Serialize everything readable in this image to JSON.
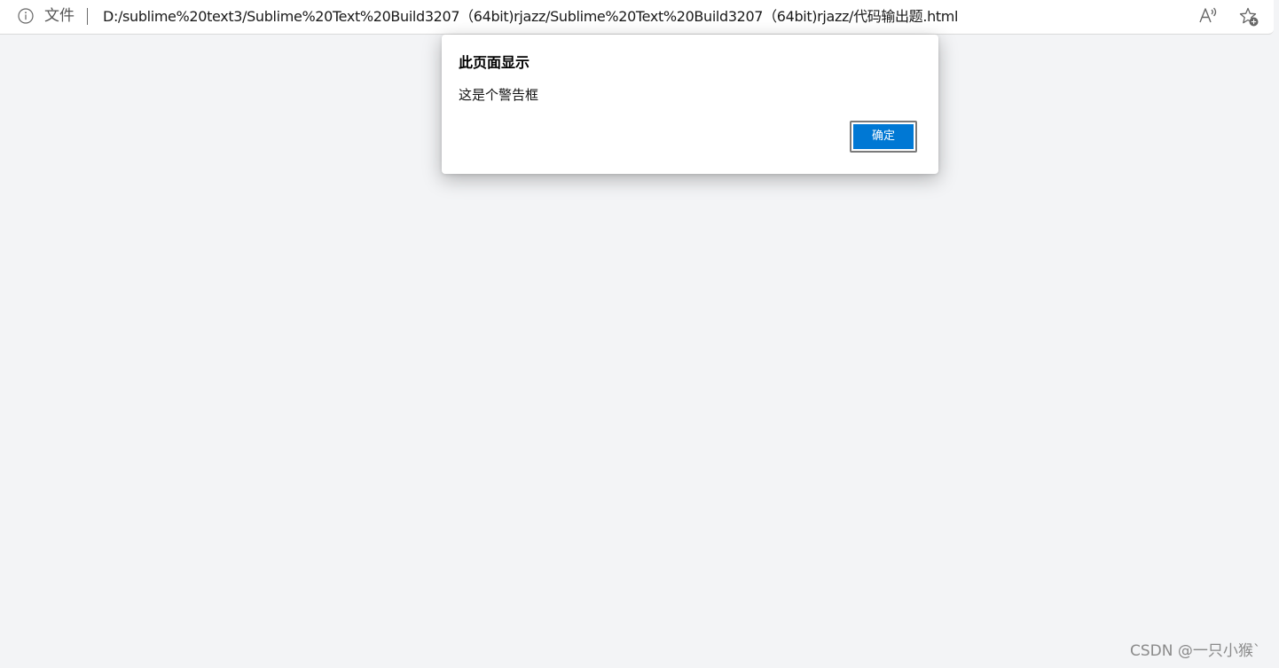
{
  "browser": {
    "info_icon": "info-icon",
    "scheme_label": "文件",
    "url": "D:/sublime%20text3/Sublime%20Text%20Build3207（64bit)rjazz/Sublime%20Text%20Build3207（64bit)rjazz/代码输出题.html",
    "read_aloud_icon": "read-aloud-icon",
    "favorite_icon": "add-favorite-icon"
  },
  "dialog": {
    "title": "此页面显示",
    "message": "这是个警告框",
    "ok_label": "确定"
  },
  "watermark": {
    "text": "CSDN @一只小猴`"
  },
  "colors": {
    "page_background": "#f3f4f6",
    "button_primary": "#0078d4"
  }
}
